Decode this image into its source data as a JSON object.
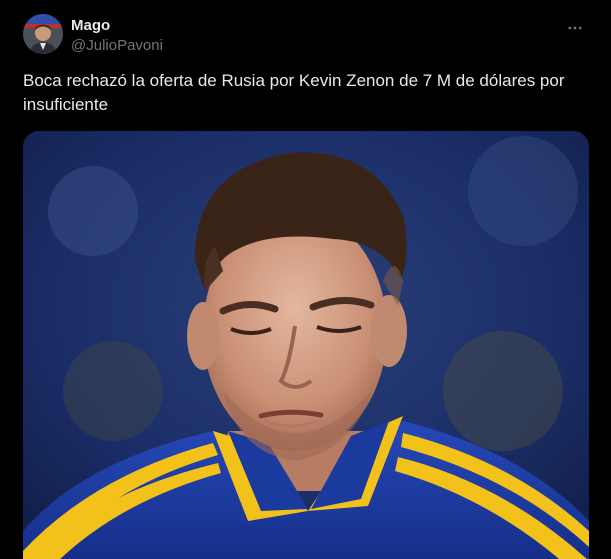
{
  "tweet": {
    "author": {
      "display_name": "Mago",
      "handle": "@JulioPavoni"
    },
    "more_icon": "more-horizontal-icon",
    "text": "Boca rechazó la oferta de Rusia por Kevin Zenon de 7 M de dólares por insuficiente"
  },
  "colors": {
    "background": "#000000",
    "primary_text": "#e7e9ea",
    "secondary_text": "#71767b",
    "jersey_blue": "#1e3fa3",
    "jersey_gold": "#f2c21b"
  }
}
